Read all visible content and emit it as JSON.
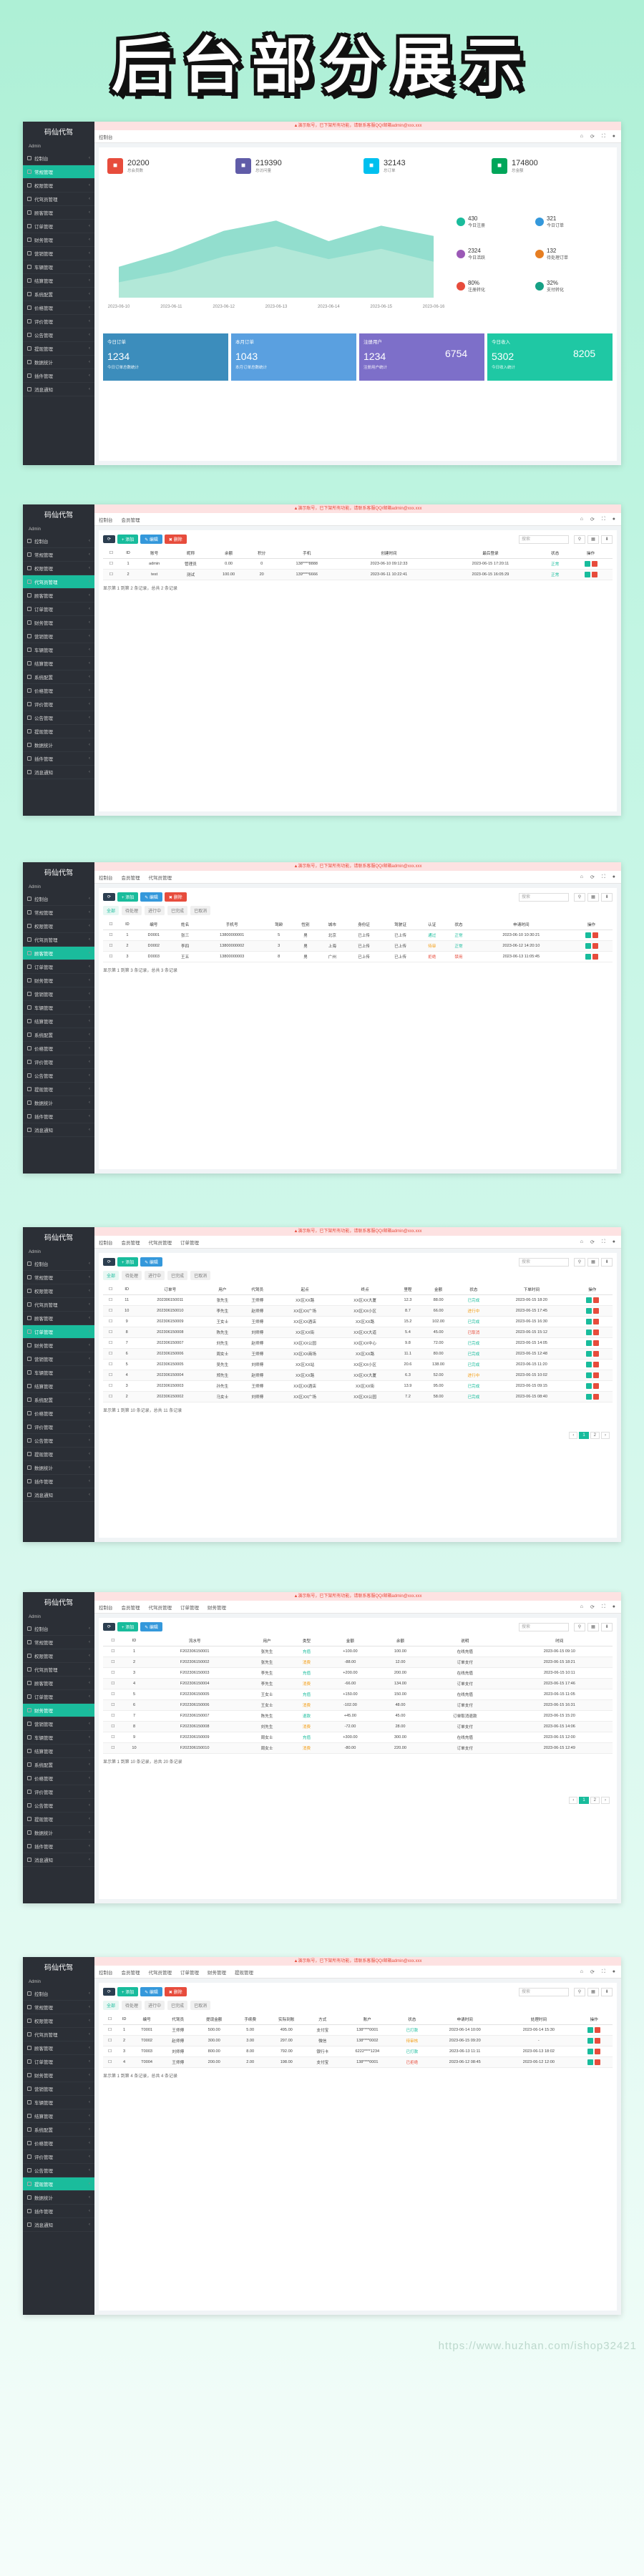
{
  "banner_title": "后台部分展示",
  "watermark": "https://www.huzhan.com/ishop32421",
  "common": {
    "logo": "码仙代驾",
    "admin_label": "Admin",
    "notice": "▲演示账号，已下架所有功能，请联系客服QQ/邮箱admin@xxx.xxx",
    "tab_home": "控制台",
    "search_placeholder": "搜索",
    "search_icon": "search-icon"
  },
  "menu": [
    "控制台",
    "常规管理",
    "权限管理",
    "代驾员管理",
    "顾客管理",
    "订单管理",
    "财务管理",
    "营销管理",
    "车辆管理",
    "结算管理",
    "系统配置",
    "价格管理",
    "评价管理",
    "公告管理",
    "提现管理",
    "数据统计",
    "插件管理",
    "消息通知"
  ],
  "shot1": {
    "tabs": [
      "概况",
      "统计"
    ],
    "title_bar": "温馨提示：当前系统为演示版本，部分功能已禁用",
    "stats": [
      {
        "num": "20200",
        "lbl": "总会员数",
        "color": "#e74c3c",
        "icon": "user-icon"
      },
      {
        "num": "219390",
        "lbl": "总访问量",
        "color": "#605ca8",
        "icon": "eye-icon"
      },
      {
        "num": "32143",
        "lbl": "总订单",
        "color": "#00c0ef",
        "icon": "cart-icon"
      },
      {
        "num": "174800",
        "lbl": "总金额",
        "color": "#00a65a",
        "icon": "money-icon"
      }
    ],
    "side_stats": [
      {
        "num": "430",
        "lbl": "今日注册"
      },
      {
        "num": "321",
        "lbl": "今日订单"
      },
      {
        "num": "2324",
        "lbl": "今日活跃"
      },
      {
        "num": "132",
        "lbl": "待处理订单"
      },
      {
        "num": "80%",
        "lbl": "注册转化"
      },
      {
        "num": "32%",
        "lbl": "支付转化"
      }
    ],
    "chart_data": {
      "type": "area",
      "x": [
        "2023-06-10",
        "2023-06-11",
        "2023-06-12",
        "2023-06-13",
        "2023-06-14",
        "2023-06-15",
        "2023-06-16"
      ],
      "series": [
        {
          "values": [
            120,
            180,
            260,
            300,
            220,
            280,
            240
          ]
        },
        {
          "values": [
            60,
            100,
            160,
            200,
            150,
            190,
            140
          ]
        }
      ]
    },
    "cards": [
      {
        "title": "今日订单",
        "num": "1234",
        "sub": "今日订单总数统计",
        "color": "#3c8dbc"
      },
      {
        "title": "本月订单",
        "num": "1043",
        "sub": "本月订单总数统计",
        "color": "#5aa0e0"
      },
      {
        "title": "注册用户",
        "num": "1234",
        "num2": "6754",
        "sub": "注册用户统计",
        "color": "#7d6fc9"
      },
      {
        "title": "今日收入",
        "num": "5302",
        "num2": "8205",
        "sub": "今日收入统计",
        "color": "#1fc8a4"
      }
    ]
  },
  "shot2": {
    "crumbs": [
      "控制台",
      "会员管理"
    ],
    "headers": [
      "ID",
      "账号",
      "昵称",
      "余额",
      "积分",
      "手机",
      "创建时间",
      "最后登录",
      "状态",
      "操作"
    ],
    "rows": [
      [
        "1",
        "admin",
        "管理员",
        "0.00",
        "0",
        "138****8888",
        "2023-06-10 09:12:33",
        "2023-06-15 17:20:11",
        "正常"
      ],
      [
        "2",
        "test",
        "测试",
        "100.00",
        "20",
        "139****6666",
        "2023-06-11 10:22:41",
        "2023-06-15 16:05:29",
        "正常"
      ]
    ],
    "footer": "显示第 1 到第 2 条记录，总共 2 条记录"
  },
  "shot3": {
    "crumbs": [
      "控制台",
      "会员管理",
      "代驾员管理"
    ],
    "headers": [
      "ID",
      "编号",
      "姓名",
      "手机号",
      "驾龄",
      "性别",
      "城市",
      "身份证",
      "驾驶证",
      "认证",
      "状态",
      "申请时间",
      "操作"
    ],
    "rows": [
      [
        "1",
        "D0001",
        "张三",
        "13800000001",
        "5",
        "男",
        "北京",
        "已上传",
        "已上传",
        "通过",
        "正常",
        "2023-06-10 10:30:21"
      ],
      [
        "2",
        "D0002",
        "李四",
        "13800000002",
        "3",
        "男",
        "上海",
        "已上传",
        "已上传",
        "待审",
        "正常",
        "2023-06-12 14:20:10"
      ],
      [
        "3",
        "D0003",
        "王五",
        "13800000003",
        "8",
        "男",
        "广州",
        "已上传",
        "已上传",
        "拒绝",
        "禁用",
        "2023-06-13 11:05:45"
      ]
    ],
    "footer": "显示第 1 到第 3 条记录，总共 3 条记录"
  },
  "shot4": {
    "crumbs": [
      "控制台",
      "会员管理",
      "代驾员管理",
      "订单管理"
    ],
    "headers": [
      "ID",
      "订单号",
      "用户",
      "代驾员",
      "起点",
      "终点",
      "里程",
      "金额",
      "状态",
      "下单时间",
      "操作"
    ],
    "rows": [
      [
        "11",
        "202306150011",
        "张先生",
        "王师傅",
        "XX区XX路",
        "XX区XX大厦",
        "12.3",
        "88.00",
        "已完成",
        "2023-06-15 18:20"
      ],
      [
        "10",
        "202306150010",
        "李先生",
        "赵师傅",
        "XX区XX广场",
        "XX区XX小区",
        "8.7",
        "66.00",
        "进行中",
        "2023-06-15 17:45"
      ],
      [
        "9",
        "202306150009",
        "王女士",
        "王师傅",
        "XX区XX酒店",
        "XX区XX路",
        "15.2",
        "102.00",
        "已完成",
        "2023-06-15 16:30"
      ],
      [
        "8",
        "202306150008",
        "陈先生",
        "刘师傅",
        "XX区XX街",
        "XX区XX大道",
        "5.4",
        "45.00",
        "已取消",
        "2023-06-15 15:12"
      ],
      [
        "7",
        "202306150007",
        "刘先生",
        "赵师傅",
        "XX区XX公园",
        "XX区XX中心",
        "9.8",
        "72.00",
        "已完成",
        "2023-06-15 14:05"
      ],
      [
        "6",
        "202306150006",
        "周女士",
        "王师傅",
        "XX区XX商场",
        "XX区XX路",
        "11.1",
        "80.00",
        "已完成",
        "2023-06-15 12:48"
      ],
      [
        "5",
        "202306150005",
        "吴先生",
        "刘师傅",
        "XX区XX站",
        "XX区XX小区",
        "20.6",
        "138.00",
        "已完成",
        "2023-06-15 11:20"
      ],
      [
        "4",
        "202306150004",
        "郑先生",
        "赵师傅",
        "XX区XX路",
        "XX区XX大厦",
        "6.3",
        "52.00",
        "进行中",
        "2023-06-15 10:02"
      ],
      [
        "3",
        "202306150003",
        "孙先生",
        "王师傅",
        "XX区XX酒店",
        "XX区XX街",
        "13.9",
        "95.00",
        "已完成",
        "2023-06-15 09:15"
      ],
      [
        "2",
        "202306150002",
        "马女士",
        "刘师傅",
        "XX区XX广场",
        "XX区XX公园",
        "7.2",
        "58.00",
        "已完成",
        "2023-06-15 08:40"
      ]
    ],
    "footer": "显示第 1 到第 10 条记录，总共 11 条记录"
  },
  "shot5": {
    "crumbs": [
      "控制台",
      "会员管理",
      "代驾员管理",
      "订单管理",
      "财务管理"
    ],
    "headers": [
      "ID",
      "流水号",
      "用户",
      "类型",
      "金额",
      "余额",
      "说明",
      "时间"
    ],
    "rows": [
      [
        "1",
        "F202306150001",
        "张先生",
        "充值",
        "+100.00",
        "100.00",
        "在线充值",
        "2023-06-15 09:10"
      ],
      [
        "2",
        "F202306150002",
        "张先生",
        "消费",
        "-88.00",
        "12.00",
        "订单支付",
        "2023-06-15 18:21"
      ],
      [
        "3",
        "F202306150003",
        "李先生",
        "充值",
        "+200.00",
        "200.00",
        "在线充值",
        "2023-06-15 10:11"
      ],
      [
        "4",
        "F202306150004",
        "李先生",
        "消费",
        "-66.00",
        "134.00",
        "订单支付",
        "2023-06-15 17:46"
      ],
      [
        "5",
        "F202306150005",
        "王女士",
        "充值",
        "+150.00",
        "150.00",
        "在线充值",
        "2023-06-15 11:05"
      ],
      [
        "6",
        "F202306150006",
        "王女士",
        "消费",
        "-102.00",
        "48.00",
        "订单支付",
        "2023-06-15 16:31"
      ],
      [
        "7",
        "F202306150007",
        "陈先生",
        "退款",
        "+45.00",
        "45.00",
        "订单取消退款",
        "2023-06-15 15:20"
      ],
      [
        "8",
        "F202306150008",
        "刘先生",
        "消费",
        "-72.00",
        "28.00",
        "订单支付",
        "2023-06-15 14:06"
      ],
      [
        "9",
        "F202306150009",
        "周女士",
        "充值",
        "+300.00",
        "300.00",
        "在线充值",
        "2023-06-15 12:00"
      ],
      [
        "10",
        "F202306150010",
        "周女士",
        "消费",
        "-80.00",
        "220.00",
        "订单支付",
        "2023-06-15 12:49"
      ]
    ],
    "footer": "显示第 1 到第 10 条记录，总共 20 条记录"
  },
  "shot6": {
    "crumbs": [
      "控制台",
      "会员管理",
      "代驾员管理",
      "订单管理",
      "财务管理",
      "提现管理"
    ],
    "headers": [
      "ID",
      "编号",
      "代驾员",
      "提现金额",
      "手续费",
      "实际到账",
      "方式",
      "账户",
      "状态",
      "申请时间",
      "处理时间",
      "操作"
    ],
    "rows": [
      [
        "1",
        "T0001",
        "王师傅",
        "500.00",
        "5.00",
        "495.00",
        "支付宝",
        "138****0001",
        "已打款",
        "2023-06-14 10:00",
        "2023-06-14 15:30"
      ],
      [
        "2",
        "T0002",
        "赵师傅",
        "300.00",
        "3.00",
        "297.00",
        "微信",
        "138****0002",
        "待审核",
        "2023-06-15 09:20",
        "-"
      ],
      [
        "3",
        "T0003",
        "刘师傅",
        "800.00",
        "8.00",
        "792.00",
        "银行卡",
        "6222****1234",
        "已打款",
        "2023-06-13 11:11",
        "2023-06-13 18:02"
      ],
      [
        "4",
        "T0004",
        "王师傅",
        "200.00",
        "2.00",
        "198.00",
        "支付宝",
        "138****0001",
        "已拒绝",
        "2023-06-12 08:45",
        "2023-06-12 12:00"
      ]
    ],
    "footer": "显示第 1 到第 4 条记录，总共 4 条记录"
  }
}
